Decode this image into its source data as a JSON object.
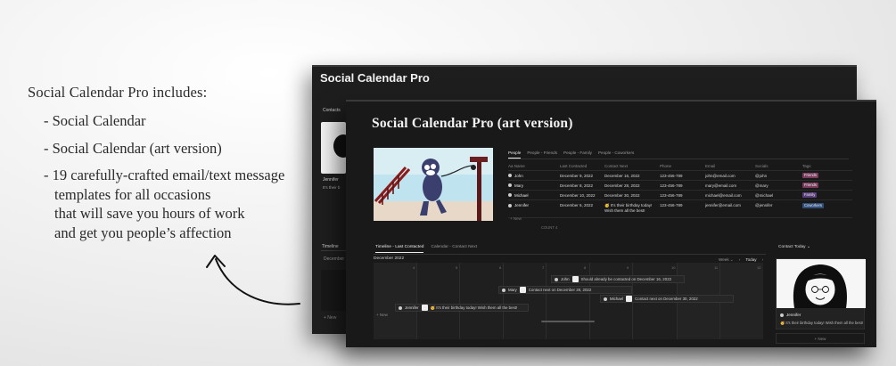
{
  "promo": {
    "heading": "Social Calendar Pro includes:",
    "items": [
      {
        "lines": [
          "- Social Calendar"
        ]
      },
      {
        "lines": [
          "- Social Calendar (art version)"
        ]
      },
      {
        "lines": [
          "- 19 carefully-crafted email/text message",
          "templates for all occasions",
          "that will save you hours of work",
          "and get you people’s affection"
        ]
      }
    ]
  },
  "back_window": {
    "title": "Social Calendar Pro",
    "side_label": "Contacts",
    "side_name": "Jennifer",
    "side_msg": "It's their b",
    "timeline_label": "Timeline",
    "month": "December",
    "new_label": "+ New"
  },
  "front_window": {
    "title": "Social Calendar Pro (art version)",
    "people_tabs": [
      "People",
      "People - Friends",
      "People - Family",
      "People - Coworkers"
    ],
    "columns": [
      "Aa Name",
      "Last Contacted",
      "Contact Next",
      "Phone",
      "Email",
      "Socials",
      "Tags"
    ],
    "rows": [
      {
        "name": "John",
        "last": "December 9, 2022",
        "next": "December 16, 2022",
        "phone": "123-456-789",
        "email": "john@email.com",
        "social": "@john",
        "tag": "Friends",
        "tag_color": "#7a3b5c"
      },
      {
        "name": "Mary",
        "last": "December 8, 2022",
        "next": "December 28, 2022",
        "phone": "123-456-789",
        "email": "mary@email.com",
        "social": "@mary",
        "tag": "Friends",
        "tag_color": "#7a3b5c"
      },
      {
        "name": "Michael",
        "last": "December 10, 2022",
        "next": "December 30, 2022",
        "phone": "123-456-789",
        "email": "michael@email.com",
        "social": "@michael",
        "tag": "Family",
        "tag_color": "#5a3e7a"
      },
      {
        "name": "Jennifer",
        "last": "December 6, 2022",
        "next": "🥳 It's their birthday today! Wish them all the best!",
        "phone": "123-456-789",
        "email": "jennifer@email.com",
        "social": "@jennifer",
        "tag": "Coworkers",
        "tag_color": "#2f4e7a"
      }
    ],
    "table_new": "+ New",
    "count_label": "COUNT 4",
    "timeline_tabs": [
      "Timeline - Last Contacted",
      "Calendar - Contact Next"
    ],
    "month": "December 2022",
    "day_numbers": [
      "4",
      "5",
      "6",
      "7",
      "8",
      "9",
      "10",
      "11",
      "12"
    ],
    "controls": {
      "week": "Week ⌄",
      "prev": "‹",
      "today": "Today",
      "next": "›"
    },
    "bars": [
      {
        "name": "John",
        "msg": "Should already be contacted on December 16, 2022"
      },
      {
        "name": "Mary",
        "msg": "Contact next on December 28, 2022"
      },
      {
        "name": "Michael",
        "msg": "Contact next on December 30, 2022"
      },
      {
        "name": "Jennifer",
        "msg": "🥳 It's their birthday today! Wish them all the best!"
      }
    ],
    "timeline_new": "+ New",
    "contact_today": {
      "label": "Contact Today ⌄",
      "name": "Jennifer",
      "msg": "🥳 It's their birthday today! Wish them all the best!",
      "new_label": "+ New"
    }
  },
  "colors": {
    "window_bg": "#191919",
    "page_bg": "#eeeeee",
    "text_dark": "#2a2a2a"
  }
}
